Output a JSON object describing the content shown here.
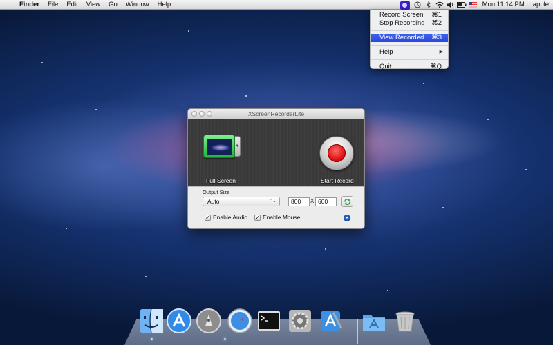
{
  "menubar": {
    "apple_symbol": "",
    "app_name": "Finder",
    "menus": [
      "File",
      "Edit",
      "View",
      "Go",
      "Window",
      "Help"
    ],
    "clock": "Mon 11:14 PM",
    "user": "apple"
  },
  "status_menu": {
    "items": [
      {
        "label": "Record Screen",
        "shortcut": "⌘1"
      },
      {
        "label": "Stop Recording",
        "shortcut": "⌘2"
      },
      {
        "label": "View Recorded",
        "shortcut": "⌘3"
      },
      {
        "label": "Help",
        "submenu_arrow": "▶"
      },
      {
        "label": "Quit",
        "shortcut": "⌘Q"
      }
    ],
    "selected": "View Recorded"
  },
  "window": {
    "title": "XScreenRecorderLite",
    "fullscreen_label": "Full Screen",
    "record_label": "Start Record",
    "output_size_label": "Output Size",
    "size_select": {
      "value": "Auto",
      "arrows": "⌃⌄"
    },
    "width": "800",
    "x_sep": "X",
    "height": "600",
    "enable_audio": {
      "label": "Enable Audio",
      "checked": true,
      "mark": "✓"
    },
    "enable_mouse": {
      "label": "Enable Mouse",
      "checked": true,
      "mark": "✓"
    },
    "dropdown_arrow": "▼"
  },
  "dock": {
    "icons": [
      "finder-icon",
      "app-store-icon",
      "launchpad-icon",
      "safari-icon",
      "terminal-icon",
      "system-preferences-icon",
      "xcode-icon",
      "applications-folder-icon",
      "trash-icon"
    ]
  },
  "colors": {
    "menu_highlight": "#2a46d8",
    "record_red": "#e01616",
    "fullscreen_green": "#22b43a"
  }
}
